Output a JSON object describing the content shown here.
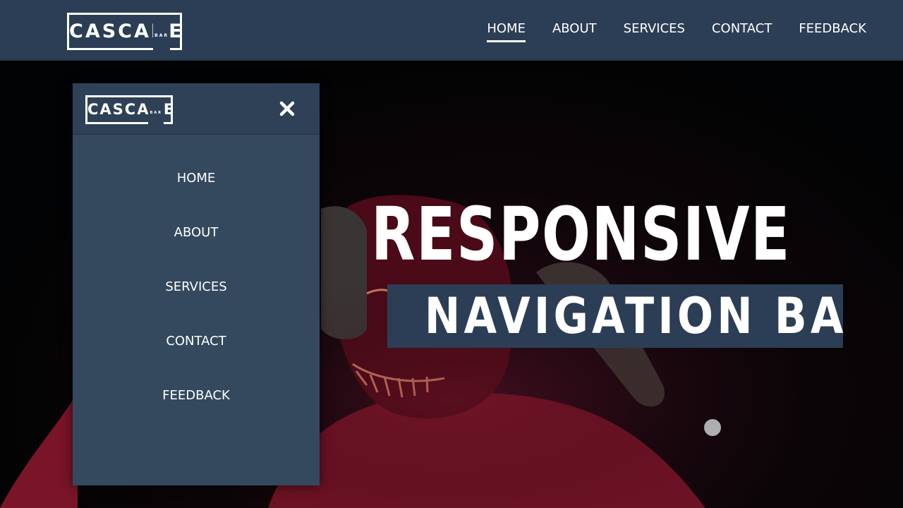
{
  "brand": {
    "name": "CASCADE",
    "sub": "BAR"
  },
  "topnav": {
    "items": [
      {
        "label": "HOME",
        "active": true
      },
      {
        "label": "ABOUT"
      },
      {
        "label": "SERVICES"
      },
      {
        "label": "CONTACT"
      },
      {
        "label": "FEEDBACK"
      }
    ]
  },
  "hero": {
    "line1": "RESPONSIVE",
    "line2": "NAVIGATION BAR"
  },
  "drawer": {
    "close_icon": "close-icon",
    "items": [
      {
        "label": "HOME"
      },
      {
        "label": "ABOUT"
      },
      {
        "label": "SERVICES"
      },
      {
        "label": "CONTACT"
      },
      {
        "label": "FEEDBACK"
      }
    ]
  },
  "colors": {
    "nav_bg": "#2c3e55",
    "drawer_bg": "#34495e",
    "text": "#ffffff"
  }
}
